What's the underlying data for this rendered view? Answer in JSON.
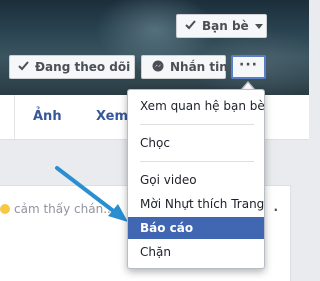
{
  "header": {
    "friend_label": "Bạn bè",
    "follow_label": "Đang theo dõi",
    "message_label": "Nhắn tin",
    "more_label": "···"
  },
  "tabs": [
    {
      "label": "Ảnh"
    },
    {
      "label": "Xem"
    }
  ],
  "card": {
    "status_text": "cảm thấy chán..."
  },
  "menu": {
    "items": [
      {
        "label": "Xem quan hệ bạn bè"
      },
      {
        "label": "Chọc"
      },
      {
        "label": "Gọi video"
      },
      {
        "label": "Mời Nhựt thích Trang"
      },
      {
        "label": "Báo cáo",
        "active": true
      },
      {
        "label": "Chặn"
      }
    ]
  },
  "colors": {
    "accent": "#4267b2",
    "link": "#365899",
    "annotation_arrow": "#2a8fd0"
  }
}
